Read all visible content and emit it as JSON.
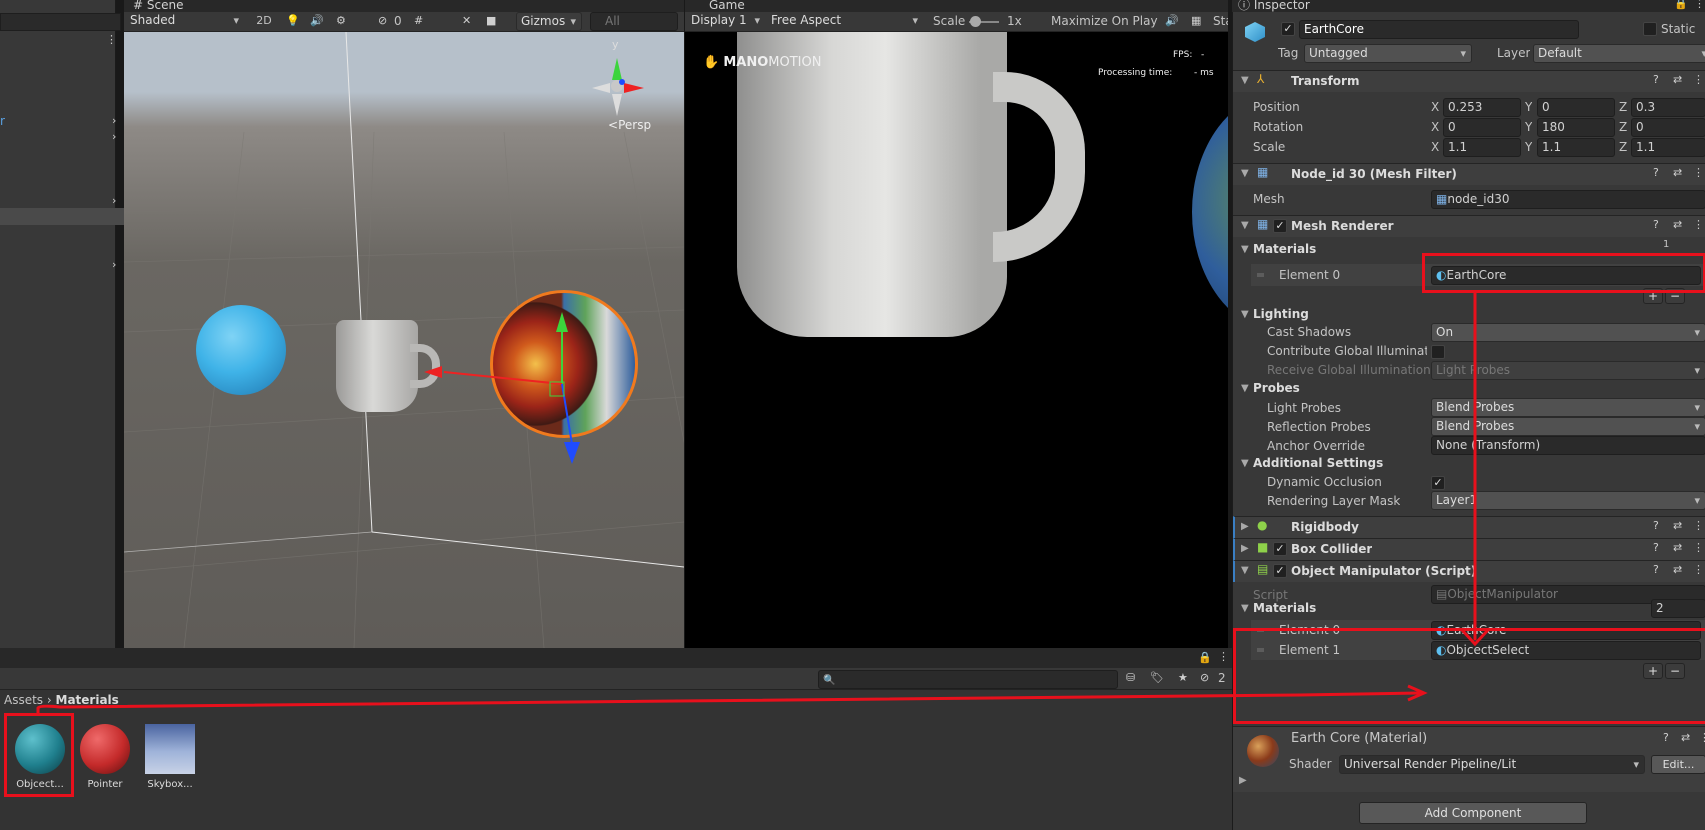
{
  "left_panel": {
    "item1": "r"
  },
  "scene": {
    "tab": "# Scene",
    "shading": "Shaded",
    "btn_2d": "2D",
    "hidden_count": "0",
    "gizmos": "Gizmos",
    "search_placeholder": "All",
    "persp": "Persp",
    "gizmo_y": "y"
  },
  "game": {
    "tab": "Game",
    "display": "Display 1",
    "aspect": "Free Aspect",
    "scale_label": "Scale",
    "scale_value": "1x",
    "maximize": "Maximize On Play",
    "stats": "Sta",
    "brand_bold": "MANO",
    "brand_light": "MOTION",
    "fps_label": "FPS:",
    "fps_value": "-",
    "proc_label": "Processing time:",
    "proc_value": "- ms"
  },
  "project": {
    "breadcrumb_root": "Assets",
    "breadcrumb_current": "Materials",
    "hidden_count": "2",
    "assets": [
      {
        "label": "Objcect...",
        "color": "#1f7f8d"
      },
      {
        "label": "Pointer",
        "color": "#c42a2a"
      },
      {
        "label": "Skybox...",
        "color": "#6e88b8"
      }
    ]
  },
  "inspector": {
    "tab": "Inspector",
    "object_name": "EarthCore",
    "static_label": "Static",
    "tag_label": "Tag",
    "tag_value": "Untagged",
    "layer_label": "Layer",
    "layer_value": "Default",
    "transform": {
      "title": "Transform",
      "rows": [
        {
          "label": "Position",
          "x": "0.253",
          "y": "0",
          "z": "0.3"
        },
        {
          "label": "Rotation",
          "x": "0",
          "y": "180",
          "z": "0"
        },
        {
          "label": "Scale",
          "x": "1.1",
          "y": "1.1",
          "z": "1.1"
        }
      ],
      "axis_x": "X",
      "axis_y": "Y",
      "axis_z": "Z"
    },
    "mesh_filter": {
      "title": "Node_id 30 (Mesh Filter)",
      "mesh_label": "Mesh",
      "mesh_value": "node_id30"
    },
    "mesh_renderer": {
      "title": "Mesh Renderer",
      "materials_label": "Materials",
      "materials_count": "1",
      "element0_label": "Element 0",
      "element0_value": "EarthCore",
      "lighting_label": "Lighting",
      "cast_shadows_label": "Cast Shadows",
      "cast_shadows_value": "On",
      "contribute_gi_label": "Contribute Global Illuminatio",
      "receive_gi_label": "Receive Global Illumination",
      "receive_gi_value": "Light Probes",
      "probes_label": "Probes",
      "light_probes_label": "Light Probes",
      "light_probes_value": "Blend Probes",
      "reflection_probes_label": "Reflection Probes",
      "reflection_probes_value": "Blend Probes",
      "anchor_label": "Anchor Override",
      "anchor_value": "None (Transform)",
      "additional_label": "Additional Settings",
      "dynamic_occlusion_label": "Dynamic Occlusion",
      "rendering_layer_label": "Rendering Layer Mask",
      "rendering_layer_value": "Layer1"
    },
    "rigidbody": {
      "title": "Rigidbody"
    },
    "box_collider": {
      "title": "Box Collider"
    },
    "object_manipulator": {
      "title": "Object Manipulator (Script)",
      "script_label": "Script",
      "script_value": "ObjectManipulator",
      "materials_label": "Materials",
      "materials_count": "2",
      "element0_label": "Element 0",
      "element0_value": "EarthCore",
      "element1_label": "Element 1",
      "element1_value": "ObjcectSelect"
    },
    "material_preview": {
      "title": "Earth Core (Material)",
      "shader_label": "Shader",
      "shader_value": "Universal Render Pipeline/Lit",
      "edit": "Edit..."
    },
    "add_component": "Add Component"
  },
  "colors": {
    "annotation": "#e8101c",
    "selection": "#2c5d87",
    "sky_cyan": "#3fb3e8"
  }
}
